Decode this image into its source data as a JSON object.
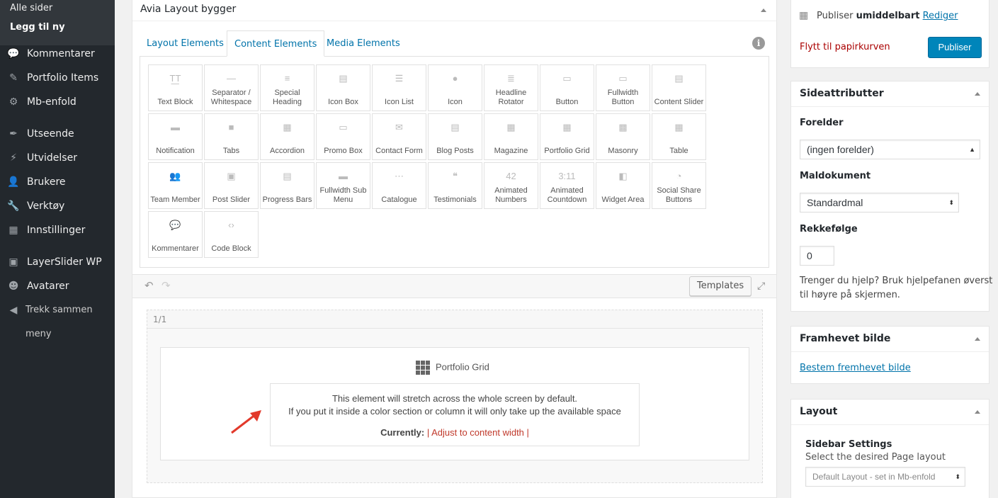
{
  "sidebar": {
    "sub": [
      "Alle sider",
      "Legg til ny"
    ],
    "items": [
      {
        "label": "Kommentarer",
        "icon": "speech-bubble-icon",
        "glyph": "💬"
      },
      {
        "label": "Portfolio Items",
        "icon": "pin-icon",
        "glyph": "✎"
      },
      {
        "label": "Mb-enfold",
        "icon": "gear-icon",
        "glyph": "⚙"
      },
      {
        "label": "Utseende",
        "icon": "brush-icon",
        "glyph": "✒"
      },
      {
        "label": "Utvidelser",
        "icon": "plug-icon",
        "glyph": "⚡"
      },
      {
        "label": "Brukere",
        "icon": "user-icon",
        "glyph": "👤"
      },
      {
        "label": "Verktøy",
        "icon": "wrench-icon",
        "glyph": "🔧"
      },
      {
        "label": "Innstillinger",
        "icon": "sliders-icon",
        "glyph": "▦"
      },
      {
        "label": "LayerSlider WP",
        "icon": "images-icon",
        "glyph": "▣"
      },
      {
        "label": "Avatarer",
        "icon": "avatar-icon",
        "glyph": "☻"
      },
      {
        "label": "Trekk sammen",
        "icon": "collapse-icon",
        "glyph": "◀"
      },
      {
        "label": "meny",
        "icon": "",
        "glyph": ""
      }
    ]
  },
  "builder": {
    "title": "Avia Layout bygger",
    "tabs": [
      "Layout Elements",
      "Content Elements",
      "Media Elements"
    ],
    "active_tab": "Content Elements",
    "elements": [
      {
        "label": "Text Block",
        "glyph": "T͟T"
      },
      {
        "label": "Separator / Whitespace",
        "glyph": "—"
      },
      {
        "label": "Special Heading",
        "glyph": "≡"
      },
      {
        "label": "Icon Box",
        "glyph": "▤"
      },
      {
        "label": "Icon List",
        "glyph": "☰"
      },
      {
        "label": "Icon",
        "glyph": "●"
      },
      {
        "label": "Headline Rotator",
        "glyph": "≣"
      },
      {
        "label": "Button",
        "glyph": "▭"
      },
      {
        "label": "Fullwidth Button",
        "glyph": "▭"
      },
      {
        "label": "Content Slider",
        "glyph": "▤"
      },
      {
        "label": "Notification",
        "glyph": "▬"
      },
      {
        "label": "Tabs",
        "glyph": "■"
      },
      {
        "label": "Accordion",
        "glyph": "▦"
      },
      {
        "label": "Promo Box",
        "glyph": "▭"
      },
      {
        "label": "Contact Form",
        "glyph": "✉"
      },
      {
        "label": "Blog Posts",
        "glyph": "▤"
      },
      {
        "label": "Magazine",
        "glyph": "▦"
      },
      {
        "label": "Portfolio Grid",
        "glyph": "▦"
      },
      {
        "label": "Masonry",
        "glyph": "▩"
      },
      {
        "label": "Table",
        "glyph": "▦"
      },
      {
        "label": "Team Member",
        "glyph": "👥"
      },
      {
        "label": "Post Slider",
        "glyph": "▣"
      },
      {
        "label": "Progress Bars",
        "glyph": "▤"
      },
      {
        "label": "Fullwidth Sub Menu",
        "glyph": "▬"
      },
      {
        "label": "Catalogue",
        "glyph": "⋯"
      },
      {
        "label": "Testimonials",
        "glyph": "❝"
      },
      {
        "label": "Animated Numbers",
        "glyph": "42"
      },
      {
        "label": "Animated Countdown",
        "glyph": "3:11"
      },
      {
        "label": "Widget Area",
        "glyph": "◧"
      },
      {
        "label": "Social Share Buttons",
        "glyph": "◔"
      },
      {
        "label": "Kommentarer",
        "glyph": "💬"
      },
      {
        "label": "Code Block",
        "glyph": "‹›"
      }
    ],
    "templates_label": "Templates",
    "cell_label": "1/1",
    "element_title": "Portfolio Grid",
    "notice_line1": "This element will stretch across the whole screen by default.",
    "notice_line2": "If you put it inside a color section or column it will only take up the available space",
    "currently_label": "Currently:",
    "currently_value": "| Adjust to content width |"
  },
  "publish": {
    "text_prefix": "Publiser",
    "text_bold": "umiddelbart",
    "edit_link": "Rediger",
    "trash_link": "Flytt til papirkurven",
    "publish_button": "Publiser"
  },
  "page_attributes": {
    "title": "Sideattributter",
    "parent_label": "Forelder",
    "parent_value": "(ingen forelder)",
    "template_label": "Maldokument",
    "template_value": "Standardmal",
    "order_label": "Rekkefølge",
    "order_value": "0",
    "help_line1": "Trenger du hjelp? Bruk hjelpefanen øverst",
    "help_line2": "til høyre på skjermen."
  },
  "featured_image": {
    "title": "Framhevet bilde",
    "link": "Bestem fremhevet bilde"
  },
  "layout_box": {
    "title": "Layout",
    "sidebar_label": "Sidebar Settings",
    "sidebar_desc": "Select the desired Page layout",
    "sidebar_value": "Default Layout - set in Mb-enfold"
  }
}
